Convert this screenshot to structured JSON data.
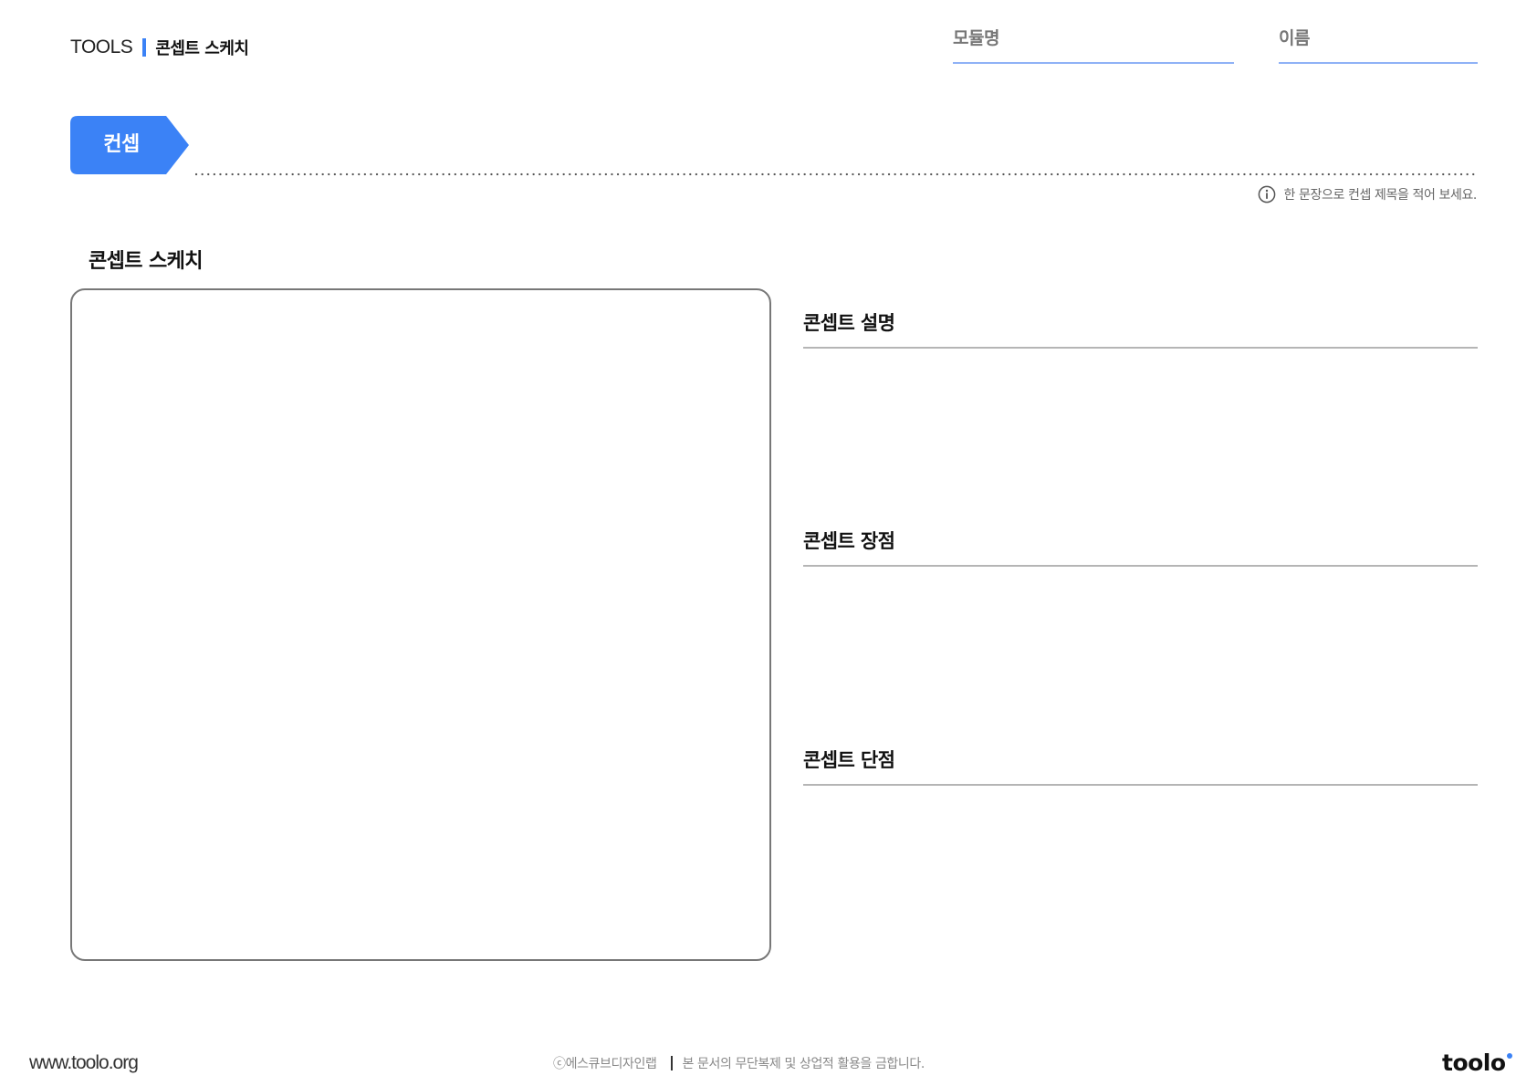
{
  "header": {
    "brand": "TOOLS",
    "title": "콘셉트 스케치",
    "fields": {
      "module_label": "모듈명",
      "name_label": "이름"
    }
  },
  "concept": {
    "tag": "컨셉",
    "hint": "한 문장으로 컨셉 제목을 적어 보세요."
  },
  "sketch": {
    "heading": "콘셉트 스케치"
  },
  "sections": {
    "description": "콘셉트 설명",
    "pros": "콘셉트 장점",
    "cons": "콘셉트 단점"
  },
  "footer": {
    "url": "www.toolo.org",
    "copyright": "ⓒ에스큐브디자인랩",
    "notice": "본 문서의 무단복제 및 상업적 활용을 금합니다.",
    "logo": "toolo"
  },
  "colors": {
    "accent": "#3b82f6",
    "field_underline": "#8fb2f6",
    "rule": "#b5b5b5",
    "box_border": "#777777"
  },
  "icons": {
    "hint": "info-icon"
  }
}
